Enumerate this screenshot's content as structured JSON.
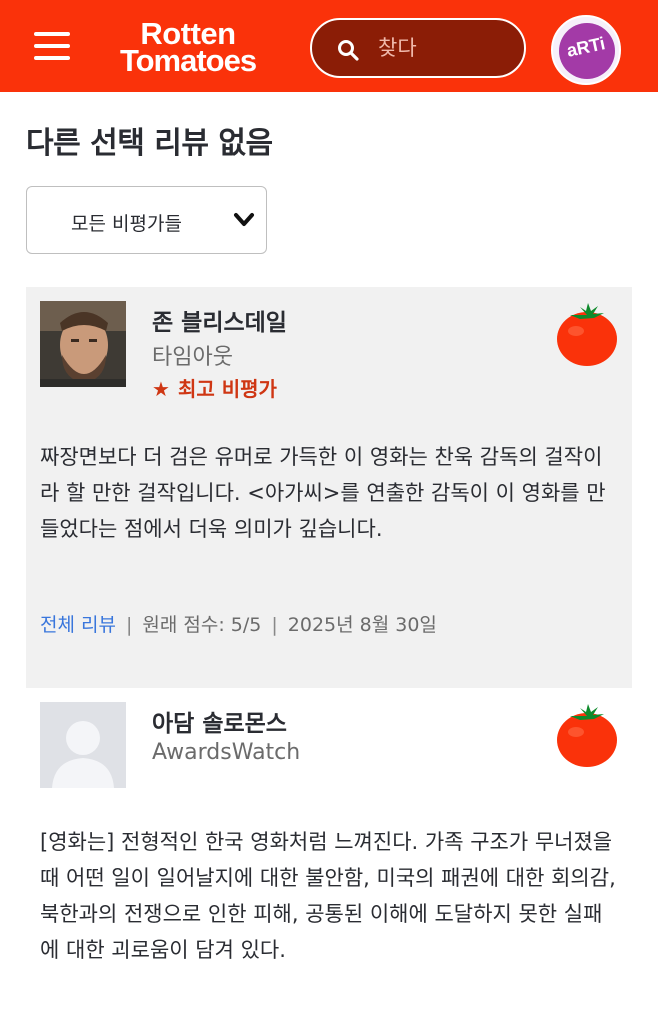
{
  "header": {
    "logo_line1": "Rotten",
    "logo_line2": "Tomatoes",
    "search_placeholder": "찾다",
    "badge_text": "aRTi",
    "brand_color": "#fa320a"
  },
  "page": {
    "title": "다른 선택 리뷰 없음",
    "filter_label": "모든 비평가들"
  },
  "reviews": [
    {
      "critic_name": "존 블리스데일",
      "publication": "타임아웃",
      "top_critic_label": "최고 비평가",
      "quote": "짜장면보다 더 검은 유머로 가득한 이 영화는 찬욱 감독의 걸작이라 할 만한 걸작입니다. <아가씨>를 연출한 감독이 이 영화를 만들었다는 점에서 더욱 의미가 깊습니다.",
      "full_review_label": "전체 리뷰",
      "original_score": "원래 점수: 5/5",
      "date": "2025년 8월 30일",
      "score_icon": "fresh-tomato-icon"
    },
    {
      "critic_name": "아담 솔로몬스",
      "publication": "AwardsWatch",
      "quote": "[영화는] 전형적인 한국 영화처럼 느껴진다. 가족 구조가 무너졌을 때 어떤 일이 일어날지에 대한 불안함, 미국의 패권에 대한 회의감, 북한과의 전쟁으로 인한 피해, 공통된 이해에 도달하지 못한 실패에 대한 괴로움이 담겨 있다.",
      "score_icon": "fresh-tomato-icon"
    }
  ]
}
